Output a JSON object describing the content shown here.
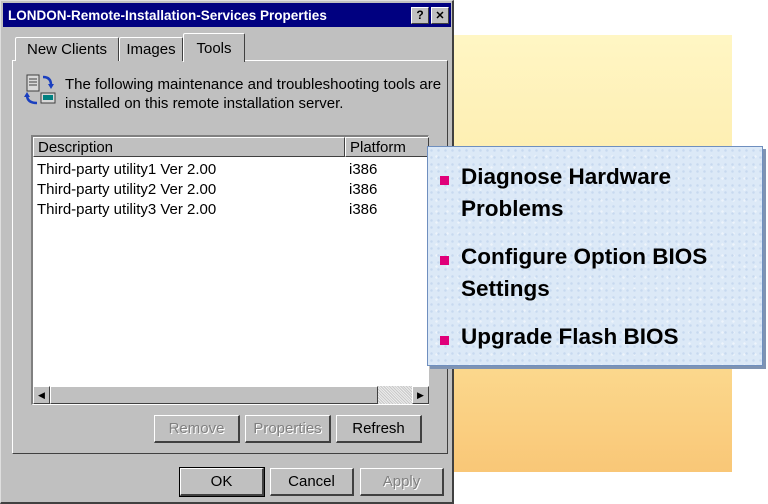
{
  "dialog": {
    "title": "LONDON-Remote-Installation-Services Properties",
    "help_button": "?",
    "close_button": "✕",
    "tabs": [
      {
        "label": "New Clients"
      },
      {
        "label": "Images"
      },
      {
        "label": "Tools"
      }
    ],
    "active_tab": "Tools",
    "intro_text": "The following maintenance and troubleshooting tools are installed on this remote installation server.",
    "list": {
      "columns": [
        "Description",
        "Platform"
      ],
      "rows": [
        {
          "description": "Third-party utility1 Ver 2.00",
          "platform": "i386"
        },
        {
          "description": "Third-party utility2 Ver 2.00",
          "platform": "i386"
        },
        {
          "description": "Third-party utility3 Ver 2.00",
          "platform": "i386"
        }
      ]
    },
    "buttons": {
      "remove": "Remove",
      "properties": "Properties",
      "refresh": "Refresh",
      "ok": "OK",
      "cancel": "Cancel",
      "apply": "Apply"
    }
  },
  "callout": {
    "bullets": [
      "Diagnose Hardware Problems",
      "Configure Option BIOS Settings",
      "Upgrade Flash BIOS"
    ],
    "bullet_color": "#e0007a"
  }
}
